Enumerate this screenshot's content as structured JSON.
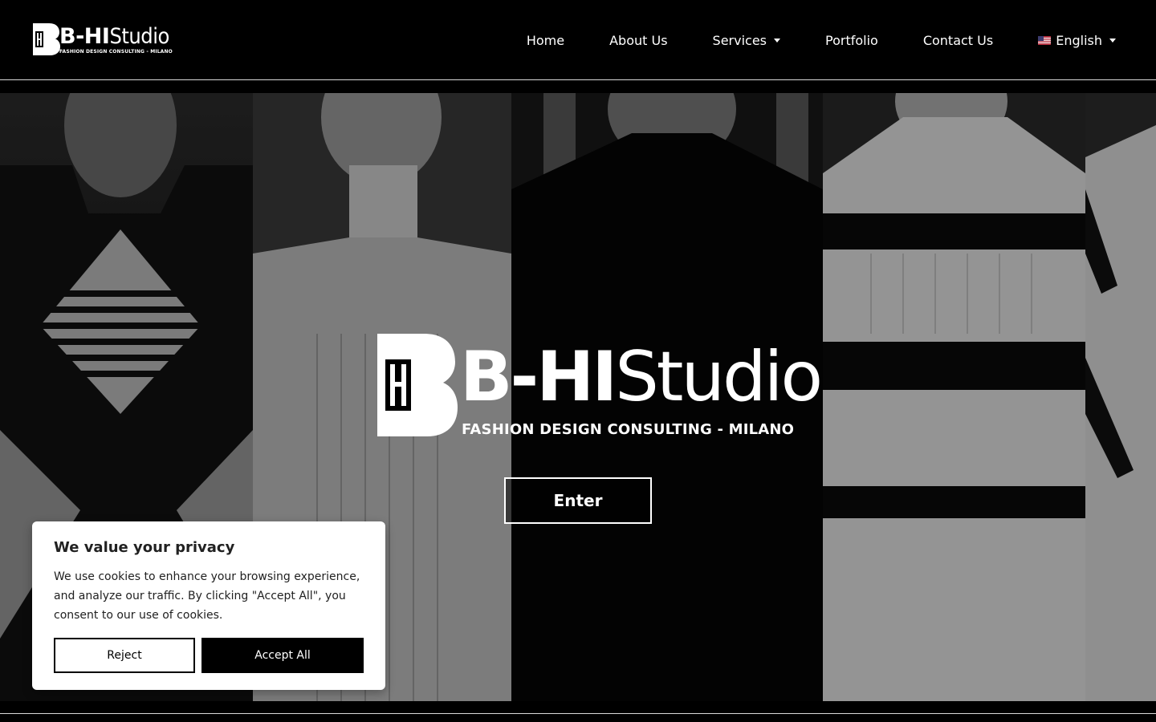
{
  "brand": {
    "name_bold": "B-HI",
    "name_light": "Studio",
    "tagline": "FASHION DESIGN CONSULTING - MILANO"
  },
  "nav": {
    "items": [
      {
        "label": "Home"
      },
      {
        "label": "About Us"
      },
      {
        "label": "Services",
        "dropdown": true
      },
      {
        "label": "Portfolio"
      },
      {
        "label": "Contact Us"
      },
      {
        "label": "English",
        "dropdown": true,
        "icon": "us-flag-icon"
      }
    ]
  },
  "hero": {
    "enter_label": "Enter"
  },
  "cookie": {
    "title": "We value your privacy",
    "text": "We use cookies to enhance your browsing experience, and analyze our traffic. By clicking \"Accept All\", you consent to our use of cookies.",
    "reject_label": "Reject",
    "accept_label": "Accept All"
  },
  "colors": {
    "background": "#000000",
    "text": "#ffffff",
    "cookie_bg": "#ffffff",
    "cookie_text": "#212121"
  }
}
